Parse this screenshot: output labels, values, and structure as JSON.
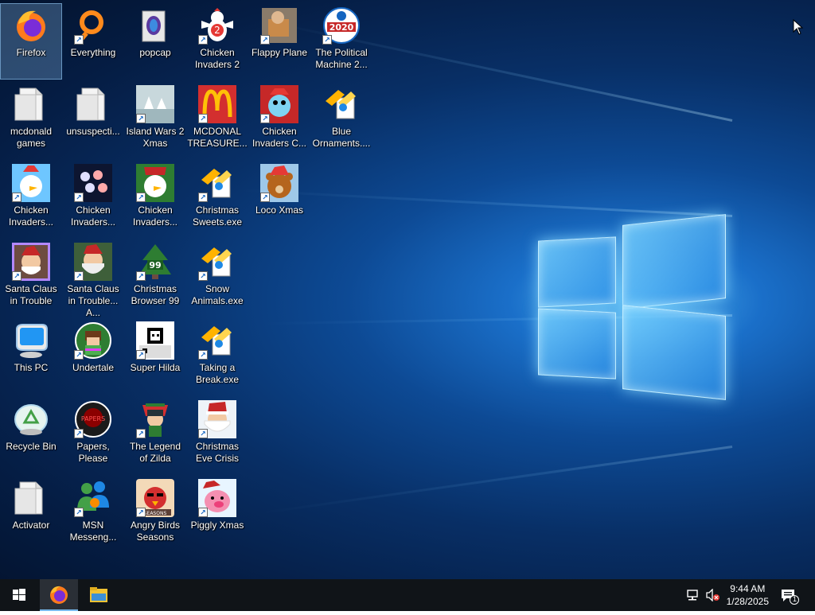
{
  "desktop": {
    "icons": [
      {
        "id": "firefox",
        "label": "Firefox",
        "shortcut": false,
        "kind": "firefox"
      },
      {
        "id": "everything",
        "label": "Everything",
        "shortcut": true,
        "kind": "everything"
      },
      {
        "id": "popcap",
        "label": "popcap",
        "shortcut": false,
        "kind": "folder-popcap"
      },
      {
        "id": "chicken-invaders-2",
        "label": "Chicken Invaders 2",
        "shortcut": true,
        "kind": "chicken2"
      },
      {
        "id": "flappy-plane",
        "label": "Flappy Plane",
        "shortcut": true,
        "kind": "photo"
      },
      {
        "id": "political-machine",
        "label": "The Political Machine 2...",
        "shortcut": true,
        "kind": "political"
      },
      {
        "id": "mcdonald-games",
        "label": "mcdonald games",
        "shortcut": false,
        "kind": "folder"
      },
      {
        "id": "unsuspecti",
        "label": "unsuspecti...",
        "shortcut": false,
        "kind": "folder"
      },
      {
        "id": "island-wars",
        "label": "Island Wars 2 Xmas",
        "shortcut": true,
        "kind": "island"
      },
      {
        "id": "mcdonal-treasure",
        "label": "MCDONAL TREASURE...",
        "shortcut": true,
        "kind": "mcd"
      },
      {
        "id": "chicken-invaders-c",
        "label": "Chicken Invaders C...",
        "shortcut": true,
        "kind": "snowman"
      },
      {
        "id": "blue-ornaments",
        "label": "Blue Ornaments....",
        "shortcut": false,
        "kind": "setup"
      },
      {
        "id": "chicken-invaders-a",
        "label": "Chicken Invaders...",
        "shortcut": true,
        "kind": "chicken"
      },
      {
        "id": "chicken-invaders-b",
        "label": "Chicken Invaders...",
        "shortcut": true,
        "kind": "eggs"
      },
      {
        "id": "chicken-invaders-d",
        "label": "Chicken Invaders...",
        "shortcut": true,
        "kind": "chickengreen"
      },
      {
        "id": "christmas-sweets",
        "label": "Christmas Sweets.exe",
        "shortcut": true,
        "kind": "setup"
      },
      {
        "id": "loco-xmas",
        "label": "Loco Xmas",
        "shortcut": true,
        "kind": "bear"
      },
      {
        "id": "santa-claus-trouble",
        "label": "Santa Claus in Trouble",
        "shortcut": true,
        "kind": "santa1"
      },
      {
        "id": "santa-claus-trouble-a",
        "label": "Santa Claus in Trouble... A...",
        "shortcut": true,
        "kind": "santa2"
      },
      {
        "id": "christmas-browser",
        "label": "Christmas Browser 99",
        "shortcut": true,
        "kind": "tree"
      },
      {
        "id": "snow-animals",
        "label": "Snow Animals.exe",
        "shortcut": true,
        "kind": "setup"
      },
      {
        "id": "this-pc",
        "label": "This PC",
        "shortcut": false,
        "kind": "thispc"
      },
      {
        "id": "undertale",
        "label": "Undertale",
        "shortcut": true,
        "kind": "undertale"
      },
      {
        "id": "super-hilda",
        "label": "Super Hilda",
        "shortcut": true,
        "kind": "hilda"
      },
      {
        "id": "taking-a-break",
        "label": "Taking a Break.exe",
        "shortcut": true,
        "kind": "setup"
      },
      {
        "id": "recycle-bin",
        "label": "Recycle Bin",
        "shortcut": false,
        "kind": "recycle"
      },
      {
        "id": "papers-please",
        "label": "Papers, Please",
        "shortcut": true,
        "kind": "papers"
      },
      {
        "id": "legend-of-zilda",
        "label": "The Legend of Zilda",
        "shortcut": true,
        "kind": "zilda"
      },
      {
        "id": "christmas-eve-crisis",
        "label": "Christmas Eve Crisis",
        "shortcut": true,
        "kind": "santa3"
      },
      {
        "id": "activator",
        "label": "Activator",
        "shortcut": false,
        "kind": "folder"
      },
      {
        "id": "msn-messenger",
        "label": "MSN Messeng...",
        "shortcut": true,
        "kind": "msn"
      },
      {
        "id": "angry-birds-seasons",
        "label": "Angry Birds Seasons",
        "shortcut": true,
        "kind": "angry"
      },
      {
        "id": "piggly-xmas",
        "label": "Piggly Xmas",
        "shortcut": true,
        "kind": "pig"
      }
    ]
  },
  "taskbar": {
    "start_icon": "windows-logo-icon",
    "pinned": [
      {
        "id": "firefox",
        "icon": "firefox-icon"
      },
      {
        "id": "explorer",
        "icon": "folder-icon"
      }
    ],
    "clock": {
      "time": "9:44 AM",
      "date": "1/28/2025"
    },
    "notifications_count": "1"
  }
}
